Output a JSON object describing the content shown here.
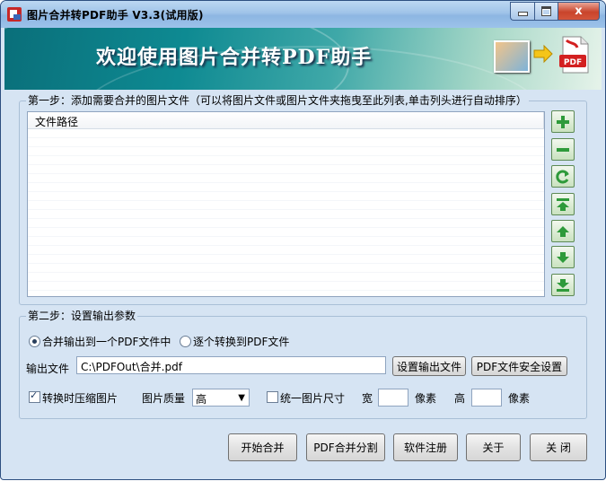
{
  "window": {
    "title": "图片合并转PDF助手 V3.3(试用版)",
    "buttons": {
      "minimize": "_",
      "maximize": "□",
      "close": "x"
    }
  },
  "banner": {
    "welcome_text": "欢迎使用图片合并转PDF助手",
    "pdf_badge": "PDF"
  },
  "step1": {
    "title": "第一步：添加需要合并的图片文件（可以将图片文件或图片文件夹拖曳至此列表,单击列头进行自动排序）",
    "column_header": "文件路径",
    "side_buttons": [
      "add",
      "remove",
      "refresh",
      "move-top",
      "move-up",
      "move-down",
      "move-bottom"
    ]
  },
  "step2": {
    "title": "第二步：设置输出参数",
    "radio_merge": "合并输出到一个PDF文件中",
    "radio_each": "逐个转换到PDF文件",
    "output_label": "输出文件",
    "output_value": "C:\\PDFOut\\合并.pdf",
    "set_output_button": "设置输出文件",
    "security_button": "PDF文件安全设置",
    "compress_label": "转换时压缩图片",
    "quality_label": "图片质量",
    "quality_value": "高",
    "unify_size_label": "统一图片尺寸",
    "width_label": "宽",
    "width_unit": "像素",
    "height_label": "高",
    "height_unit": "像素"
  },
  "state": {
    "merge_selected": true,
    "compress_checked": true,
    "unify_checked": false
  },
  "actions": {
    "start": "开始合并",
    "split": "PDF合并分割",
    "register": "软件注册",
    "about": "关于",
    "close": "关 闭"
  },
  "colors": {
    "window_bg": "#d6e4f3",
    "accent_green": "#2e9a3a",
    "close_red": "#c9442b"
  }
}
